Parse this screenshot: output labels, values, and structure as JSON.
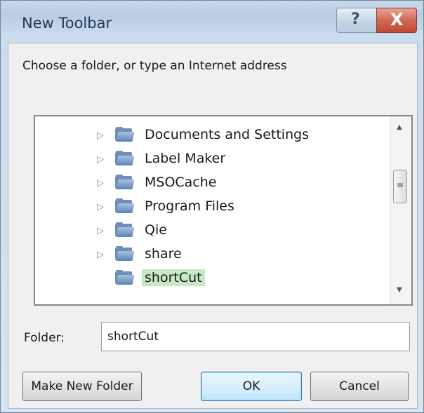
{
  "window": {
    "title": "New Toolbar",
    "help_label": "?",
    "close_label": "X"
  },
  "prompt": "Choose a folder, or type an Internet address",
  "tree": {
    "items": [
      {
        "label": "Documents and Settings",
        "expandable": true,
        "selected": false
      },
      {
        "label": "Label Maker",
        "expandable": true,
        "selected": false
      },
      {
        "label": "MSOCache",
        "expandable": true,
        "selected": false
      },
      {
        "label": "Program Files",
        "expandable": true,
        "selected": false
      },
      {
        "label": "Qie",
        "expandable": true,
        "selected": false
      },
      {
        "label": "share",
        "expandable": true,
        "selected": false
      },
      {
        "label": "shortCut",
        "expandable": false,
        "selected": true
      }
    ],
    "expand_glyph": "▷",
    "scroll_up_glyph": "▲",
    "scroll_down_glyph": "▼",
    "thumb_glyph": "≡"
  },
  "folder_field": {
    "label": "Folder:",
    "value": "shortCut"
  },
  "buttons": {
    "make_new_folder": "Make New Folder",
    "ok": "OK",
    "cancel": "Cancel"
  },
  "colors": {
    "selection": "#c6e9c4",
    "close_button": "#c04a34",
    "title_text": "#1d3a5a"
  }
}
